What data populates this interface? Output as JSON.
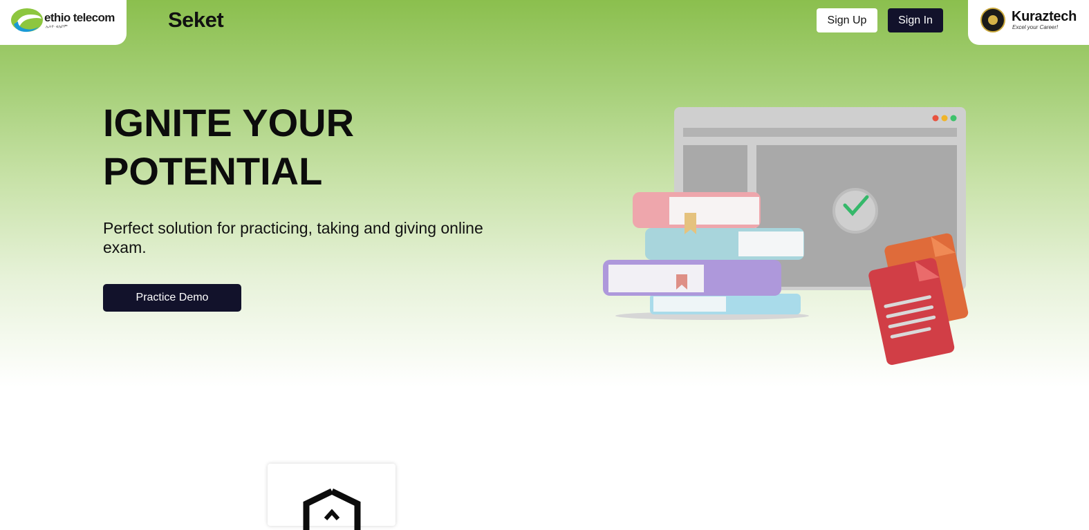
{
  "header": {
    "brand_logo": {
      "name": "ethio telecom",
      "tagline": "ኢትዮ ቴሌኮም",
      "icon": "ethio-telecom-logo"
    },
    "app_title": "Seket",
    "sign_up_label": "Sign Up",
    "sign_in_label": "Sign In",
    "partner_logo": {
      "name": "Kuraztech",
      "tagline": "Excel your Career!",
      "icon": "kuraztech-badge"
    }
  },
  "hero": {
    "headline_line1": "IGNITE YOUR",
    "headline_line2": "POTENTIAL",
    "subtitle": "Perfect solution for practicing, taking and giving online exam.",
    "cta_label": "Practice Demo",
    "illustration": "books-browser-documents-illustration"
  },
  "features": {
    "first_card_icon": "shield-icon"
  },
  "colors": {
    "hero_green": "#8bbf4e",
    "dark_button": "#12122b",
    "white": "#ffffff"
  }
}
